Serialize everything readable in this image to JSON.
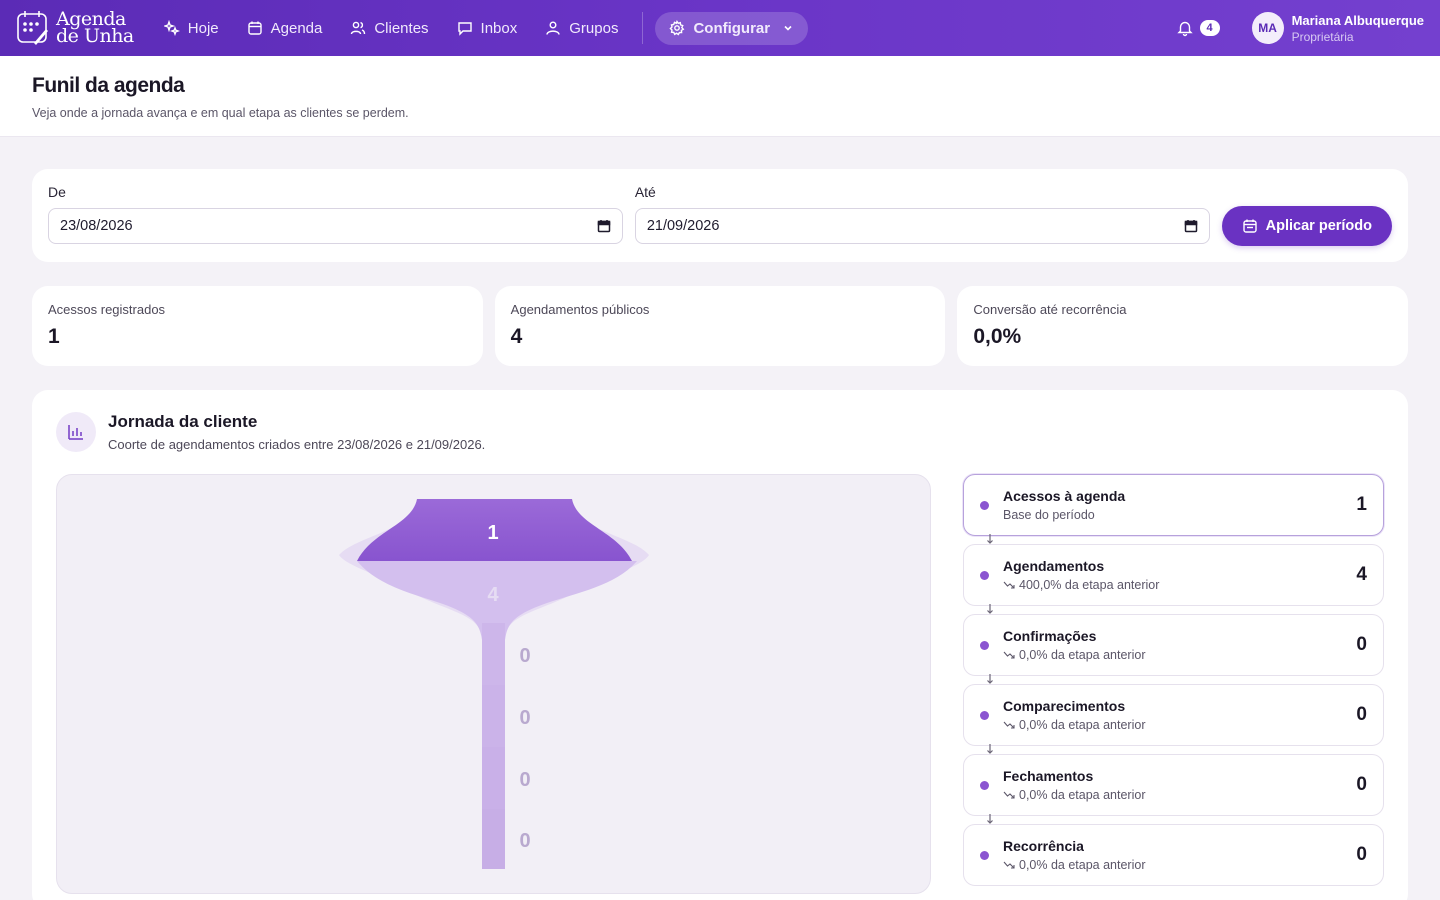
{
  "brand": {
    "line1": "Agenda",
    "line2": "de Unha"
  },
  "nav": {
    "items": [
      {
        "label": "Hoje",
        "icon": "sparkles-icon"
      },
      {
        "label": "Agenda",
        "icon": "calendar-icon"
      },
      {
        "label": "Clientes",
        "icon": "users-icon"
      },
      {
        "label": "Inbox",
        "icon": "chat-icon"
      },
      {
        "label": "Grupos",
        "icon": "group-icon"
      }
    ],
    "config_label": "Configurar"
  },
  "notifications": {
    "count": "4"
  },
  "user": {
    "initials": "MA",
    "name": "Mariana Albuquerque",
    "role": "Proprietária"
  },
  "page": {
    "title": "Funil da agenda",
    "subtitle": "Veja onde a jornada avança e em qual etapa as clientes se perdem."
  },
  "filter": {
    "from_label": "De",
    "from_value": "23/08/2026",
    "to_label": "Até",
    "to_value": "21/09/2026",
    "apply_label": "Aplicar período"
  },
  "stats": [
    {
      "label": "Acessos registrados",
      "value": "1"
    },
    {
      "label": "Agendamentos públicos",
      "value": "4"
    },
    {
      "label": "Conversão até recorrência",
      "value": "0,0%"
    }
  ],
  "journey": {
    "title": "Jornada da cliente",
    "subtitle": "Coorte de agendamentos criados entre 23/08/2026 e 21/09/2026.",
    "steps": [
      {
        "name": "Acessos à agenda",
        "note": "Base do período",
        "count": "1"
      },
      {
        "name": "Agendamentos",
        "note": "400,0% da etapa anterior",
        "count": "4"
      },
      {
        "name": "Confirmações",
        "note": "0,0% da etapa anterior",
        "count": "0"
      },
      {
        "name": "Comparecimentos",
        "note": "0,0% da etapa anterior",
        "count": "0"
      },
      {
        "name": "Fechamentos",
        "note": "0,0% da etapa anterior",
        "count": "0"
      },
      {
        "name": "Recorrência",
        "note": "0,0% da etapa anterior",
        "count": "0"
      }
    ]
  },
  "colors": {
    "primary": "#6a32c2",
    "funnel_dark": "#8b55d1",
    "funnel_light": "#cdb6ea"
  }
}
